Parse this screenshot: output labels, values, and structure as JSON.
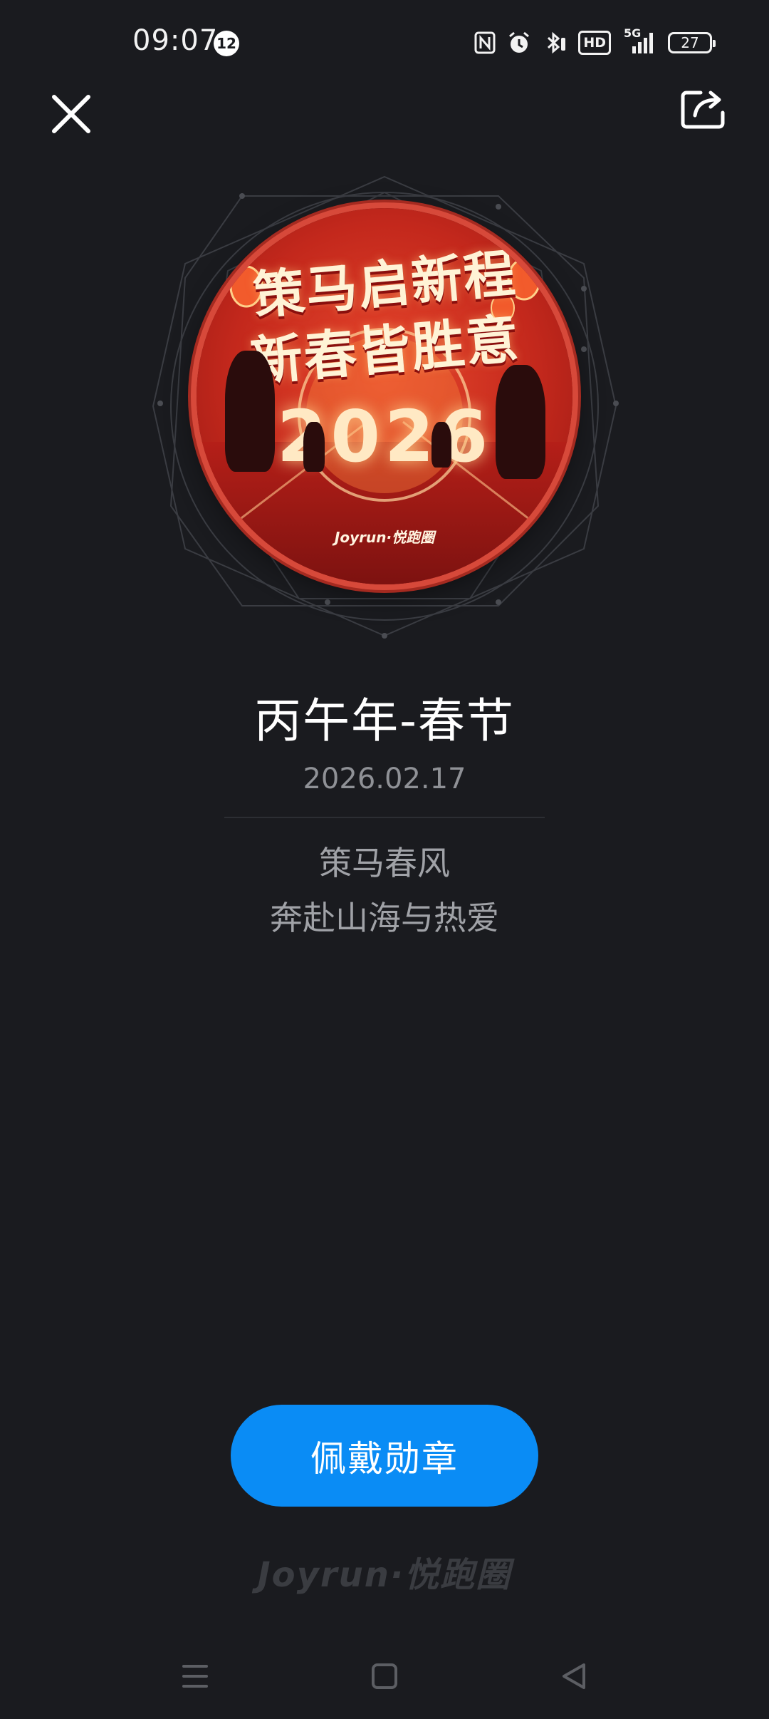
{
  "status_bar": {
    "time": "09:07",
    "notification_count": "12",
    "network": "5G",
    "hd_label": "HD",
    "battery": "27"
  },
  "medal": {
    "headline_line1": "策马启新程",
    "headline_line2": "新春皆胜意",
    "year": "2026",
    "brand": "Joyrun·悦跑圈"
  },
  "badge": {
    "title": "丙午年-春节",
    "date": "2026.02.17",
    "description_line1": "策马春风",
    "description_line2": "奔赴山海与热爱"
  },
  "actions": {
    "wear_button_label": "佩戴勋章"
  },
  "footer": {
    "brand": "Joyrun·悦跑圈"
  },
  "colors": {
    "background": "#1a1b1f",
    "accent": "#0a8cf5"
  }
}
